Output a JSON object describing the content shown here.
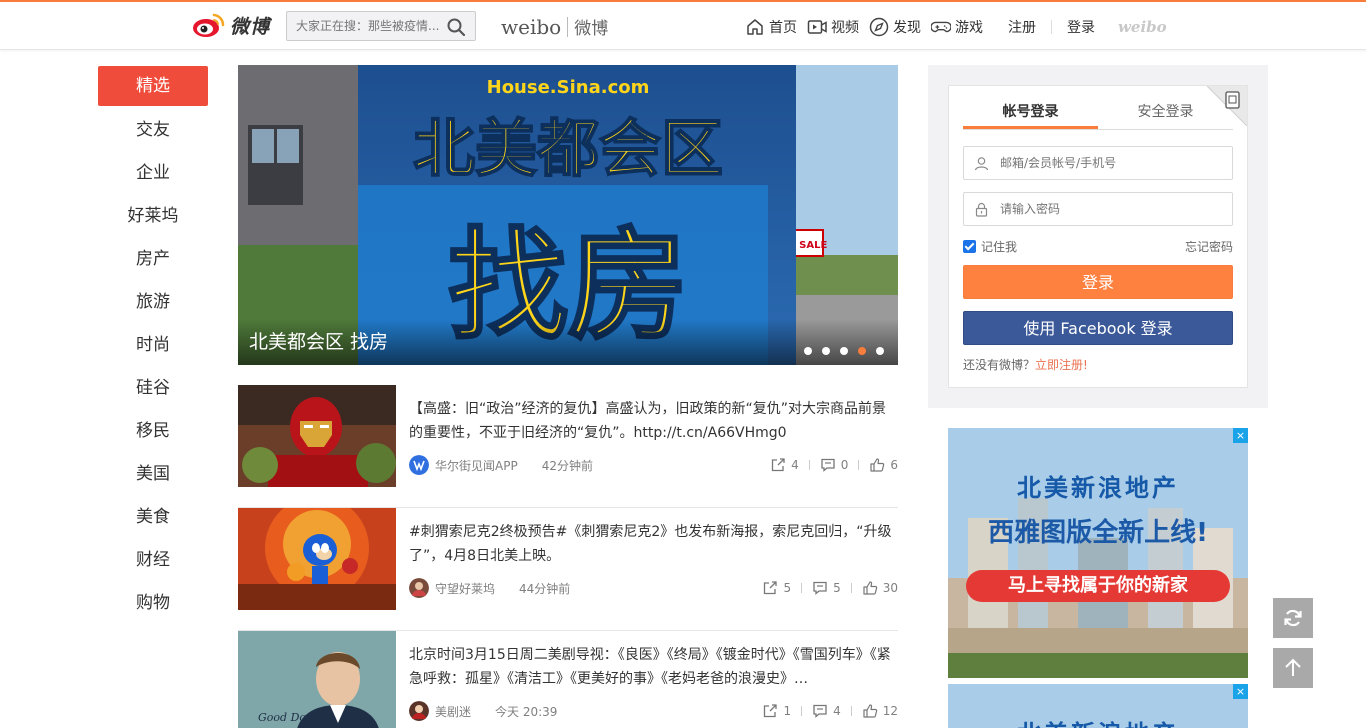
{
  "header": {
    "logo_text": "微博",
    "search_placeholder": "大家正在搜：那些被疫情...",
    "brand_en": "weibo",
    "brand_cn": "微博",
    "nav": [
      {
        "label": "首页",
        "icon": "home-icon"
      },
      {
        "label": "视频",
        "icon": "video-icon"
      },
      {
        "label": "发现",
        "icon": "compass-icon"
      },
      {
        "label": "游戏",
        "icon": "gamepad-icon"
      }
    ],
    "register": "注册",
    "login": "登录",
    "weibo_mark": "weibo"
  },
  "sidebar": {
    "items": [
      "精选",
      "交友",
      "企业",
      "好莱坞",
      "房产",
      "旅游",
      "时尚",
      "硅谷",
      "移民",
      "美国",
      "美食",
      "财经",
      "购物"
    ],
    "active_index": 0
  },
  "banner": {
    "site": "House.Sina.com",
    "headline_top": "北美都会区",
    "headline_big": "找房",
    "sign": "FOR SALE",
    "caption": "北美都会区 找房",
    "dots": 5,
    "active_dot": 3
  },
  "feed": [
    {
      "text": "【高盛：旧“政治”经济的复仇】高盛认为，旧政策的新“复仇”对大宗商品前景的重要性，不亚于旧经济的“复仇”。http://t.cn/A66VHmg0",
      "source": "华尔街见闻APP",
      "time": "42分钟前",
      "reposts": "4",
      "comments": "0",
      "likes": "6"
    },
    {
      "text": "#刺猬索尼克2终极预告#《刺猬索尼克2》也发布新海报，索尼克回归，“升级了”，4月8日北美上映。",
      "source": "守望好莱坞",
      "time": "44分钟前",
      "reposts": "5",
      "comments": "5",
      "likes": "30"
    },
    {
      "text": "北京时间3月15日周二美剧导视：《良医》《终局》《镀金时代》《雪国列车》《紧急呼救：孤星》《清洁工》《更美好的事》《老妈老爸的浪漫史》…",
      "source": "美剧迷",
      "time": "今天 20:39",
      "reposts": "1",
      "comments": "4",
      "likes": "12",
      "thumb_label": "Good Doctor"
    }
  ],
  "login": {
    "tab_account": "帐号登录",
    "tab_secure": "安全登录",
    "user_placeholder": "邮箱/会员帐号/手机号",
    "pass_placeholder": "请输入密码",
    "remember": "记住我",
    "forgot": "忘记密码",
    "login_btn": "登录",
    "fb_btn": "使用 Facebook 登录",
    "no_account": "还没有微博？",
    "register_now": "立即注册!"
  },
  "ad": {
    "line1": "北美新浪地产",
    "line2": "西雅图版全新上线!",
    "line3": "马上寻找属于你的新家",
    "close": "×"
  },
  "colors": {
    "accent": "#fa7d3c",
    "sidebar_active": "#f04c3c",
    "facebook": "#3b5998",
    "link": "#eb7350"
  }
}
